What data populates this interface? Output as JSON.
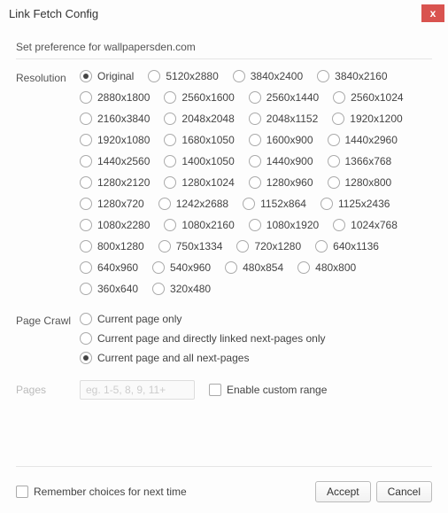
{
  "window": {
    "title": "Link Fetch Config",
    "close_icon": "x"
  },
  "subtitle": "Set preference for wallpapersden.com",
  "sections": {
    "resolution": {
      "label": "Resolution",
      "selected": "Original",
      "options": [
        "Original",
        "5120x2880",
        "3840x2400",
        "3840x2160",
        "2880x1800",
        "2560x1600",
        "2560x1440",
        "2560x1024",
        "2160x3840",
        "2048x2048",
        "2048x1152",
        "1920x1200",
        "1920x1080",
        "1680x1050",
        "1600x900",
        "1440x2960",
        "1440x2560",
        "1400x1050",
        "1440x900",
        "1366x768",
        "1280x2120",
        "1280x1024",
        "1280x960",
        "1280x800",
        "1280x720",
        "1242x2688",
        "1152x864",
        "1125x2436",
        "1080x2280",
        "1080x2160",
        "1080x1920",
        "1024x768",
        "800x1280",
        "750x1334",
        "720x1280",
        "640x1136",
        "640x960",
        "540x960",
        "480x854",
        "480x800",
        "360x640",
        "320x480"
      ]
    },
    "pagecrawl": {
      "label": "Page Crawl",
      "selected": 2,
      "options": [
        "Current page only",
        "Current page and directly linked next-pages only",
        "Current page and all next-pages"
      ]
    },
    "pages": {
      "label": "Pages",
      "placeholder": "eg. 1-5, 8, 9, 11+",
      "enable_label": "Enable custom range"
    }
  },
  "footer": {
    "remember_label": "Remember choices for next time",
    "accept_label": "Accept",
    "cancel_label": "Cancel"
  }
}
